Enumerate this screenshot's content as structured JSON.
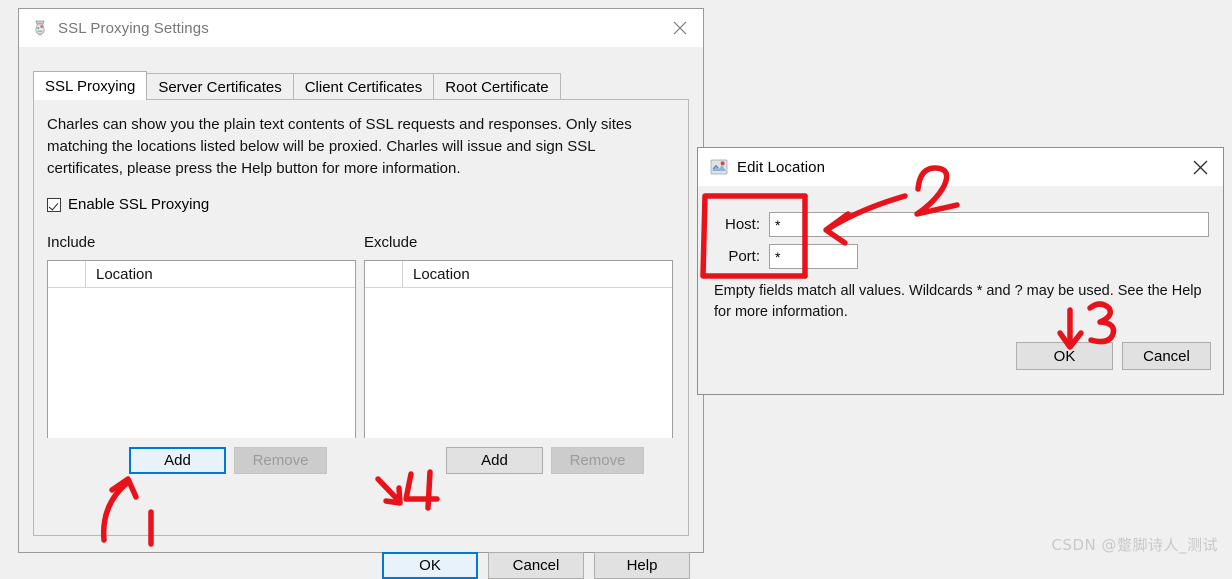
{
  "ssl_window": {
    "title": "SSL Proxying Settings",
    "icon": "charles-jug-icon",
    "close_icon": "close-icon",
    "tabs": [
      {
        "label": "SSL Proxying",
        "active": true
      },
      {
        "label": "Server Certificates",
        "active": false
      },
      {
        "label": "Client Certificates",
        "active": false
      },
      {
        "label": "Root Certificate",
        "active": false
      }
    ],
    "description": "Charles can show you the plain text contents of SSL requests and responses. Only sites matching the locations listed below will be proxied. Charles will issue and sign SSL certificates, please press the Help button for more information.",
    "enable_checkbox": {
      "label": "Enable SSL Proxying",
      "checked": true
    },
    "include": {
      "group_label": "Include",
      "column_header": "Location",
      "rows": [],
      "add_label": "Add",
      "remove_label": "Remove",
      "remove_disabled": true,
      "add_focused": true
    },
    "exclude": {
      "group_label": "Exclude",
      "column_header": "Location",
      "rows": [],
      "add_label": "Add",
      "remove_label": "Remove",
      "remove_disabled": true,
      "add_focused": false
    },
    "buttons": {
      "ok": "OK",
      "cancel": "Cancel",
      "help": "Help"
    }
  },
  "edit_window": {
    "title": "Edit Location",
    "icon": "charles-location-icon",
    "close_icon": "close-icon",
    "host": {
      "label": "Host:",
      "value": "*",
      "placeholder": ""
    },
    "port": {
      "label": "Port:",
      "value": "*",
      "placeholder": ""
    },
    "note": "Empty fields match all values. Wildcards * and ? may be used. See the Help for more information.",
    "buttons": {
      "ok": "OK",
      "cancel": "Cancel"
    }
  },
  "annotations": {
    "markers": [
      "1",
      "2",
      "3",
      "4"
    ],
    "color": "#e8131a"
  },
  "watermark": "CSDN @蹩脚诗人_测试"
}
